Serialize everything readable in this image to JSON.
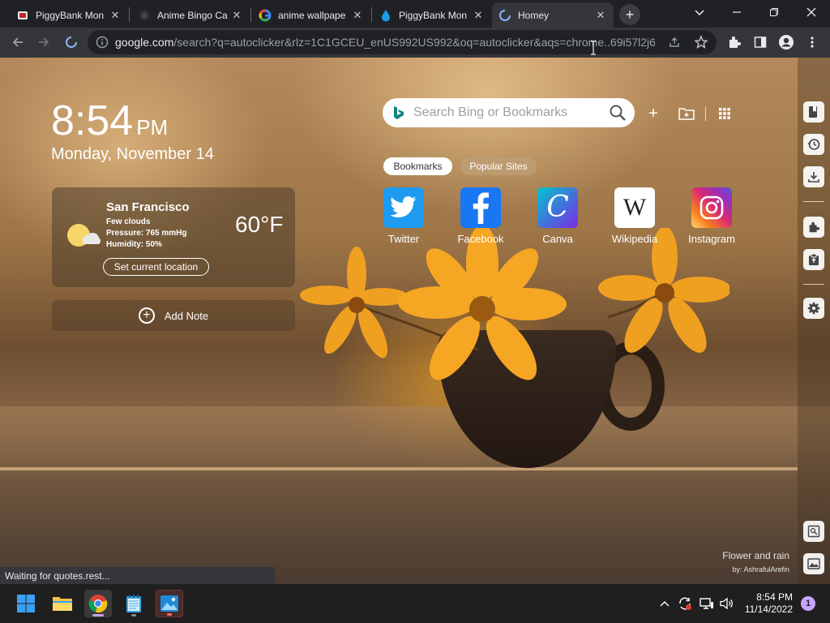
{
  "browser": {
    "tabs": [
      {
        "title": "PiggyBank Mon",
        "active": false
      },
      {
        "title": "Anime Bingo Ca",
        "active": false
      },
      {
        "title": "anime wallpape",
        "active": false
      },
      {
        "title": "PiggyBank Mon",
        "active": false
      },
      {
        "title": "Homey",
        "active": true
      }
    ],
    "url_main": "google.com",
    "url_rest": "/search?q=autoclicker&rlz=1C1GCEU_enUS992US992&oq=autoclicker&aqs=chrome..69i57l2j6..."
  },
  "homey": {
    "clock": {
      "time": "8:54",
      "ampm": "PM",
      "date": "Monday, November 14"
    },
    "weather": {
      "city": "San Francisco",
      "condition": "Few clouds",
      "pressure": "Pressure: 765 mmHg",
      "humidity": "Humidity: 50%",
      "temperature": "60°F",
      "set_location_label": "Set current location"
    },
    "add_note_label": "Add Note",
    "search_placeholder": "Search Bing or Bookmarks",
    "pills": {
      "bookmarks": "Bookmarks",
      "popular": "Popular Sites"
    },
    "sites": [
      {
        "label": "Twitter",
        "color": "#1d9bf0"
      },
      {
        "label": "Facebook",
        "color": "#1877f2"
      },
      {
        "label": "Canva",
        "color": "#7d2ae8"
      },
      {
        "label": "Wikipedia",
        "color": "#ffffff"
      },
      {
        "label": "Instagram",
        "color": "#d6249f"
      }
    ],
    "credit": {
      "title": "Flower and rain",
      "author": "by: AshrafulArefin"
    }
  },
  "status_text": "Waiting for quotes.rest...",
  "taskbar": {
    "time": "8:54 PM",
    "date": "11/14/2022",
    "notifications": "1"
  }
}
